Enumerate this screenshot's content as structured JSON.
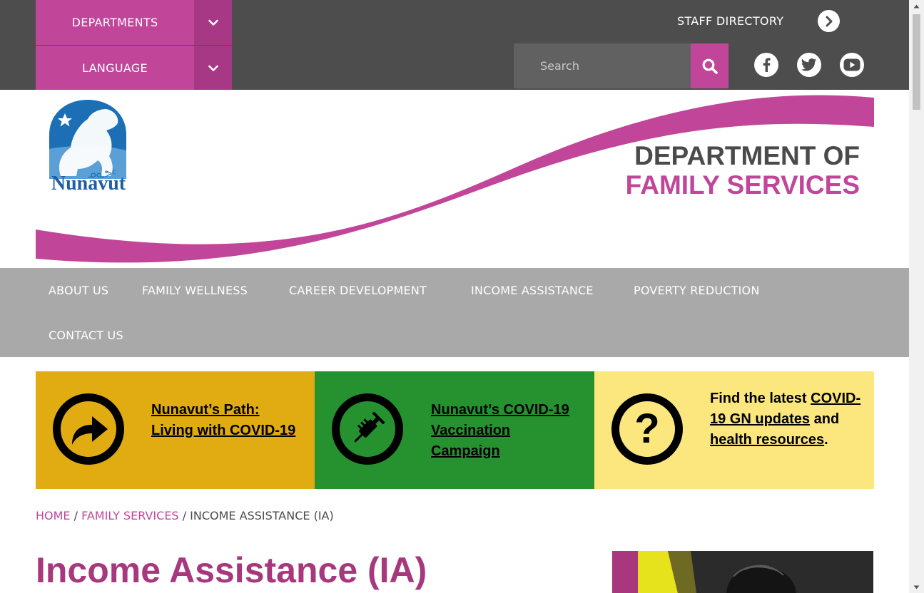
{
  "topbar": {
    "departments_label": "DEPARTMENTS",
    "language_label": "LANGUAGE",
    "staff_directory_label": "STAFF DIRECTORY",
    "search": {
      "placeholder": "Search"
    },
    "social": [
      "facebook-icon",
      "twitter-icon",
      "youtube-icon"
    ]
  },
  "header": {
    "logo_text": "Nunavut",
    "title_line1": "DEPARTMENT OF",
    "title_line2": "FAMILY SERVICES"
  },
  "nav": {
    "items": [
      "ABOUT US",
      "FAMILY WELLNESS",
      "CAREER DEVELOPMENT",
      "INCOME ASSISTANCE",
      "POVERTY REDUCTION",
      "CONTACT US"
    ]
  },
  "banners": {
    "path": {
      "link": "Nunavut’s Path: Living with COVID-19",
      "icon": "arrow-right-icon"
    },
    "vaccination": {
      "link": "Nunavut’s COVID-19 Vaccination Campaign",
      "icon": "syringe-icon"
    },
    "updates": {
      "prefix": "Find the latest",
      "link1": "COVID-19 GN updates",
      "middle": "and",
      "link2": "health resources",
      "suffix": ".",
      "icon": "question-mark-icon"
    }
  },
  "breadcrumb": {
    "home": "HOME",
    "family_services": "FAMILY SERVICES",
    "current": "INCOME ASSISTANCE (IA)",
    "separator": "/"
  },
  "page": {
    "title": "Income Assistance (IA)"
  },
  "colors": {
    "accent": "#c1469a",
    "topbar": "#4d4d4d",
    "nav": "#a9a9a9",
    "banner_yellow": "#e0ac12",
    "banner_green": "#26922f",
    "banner_light_yellow": "#fbe77e",
    "title": "#a7387d"
  }
}
